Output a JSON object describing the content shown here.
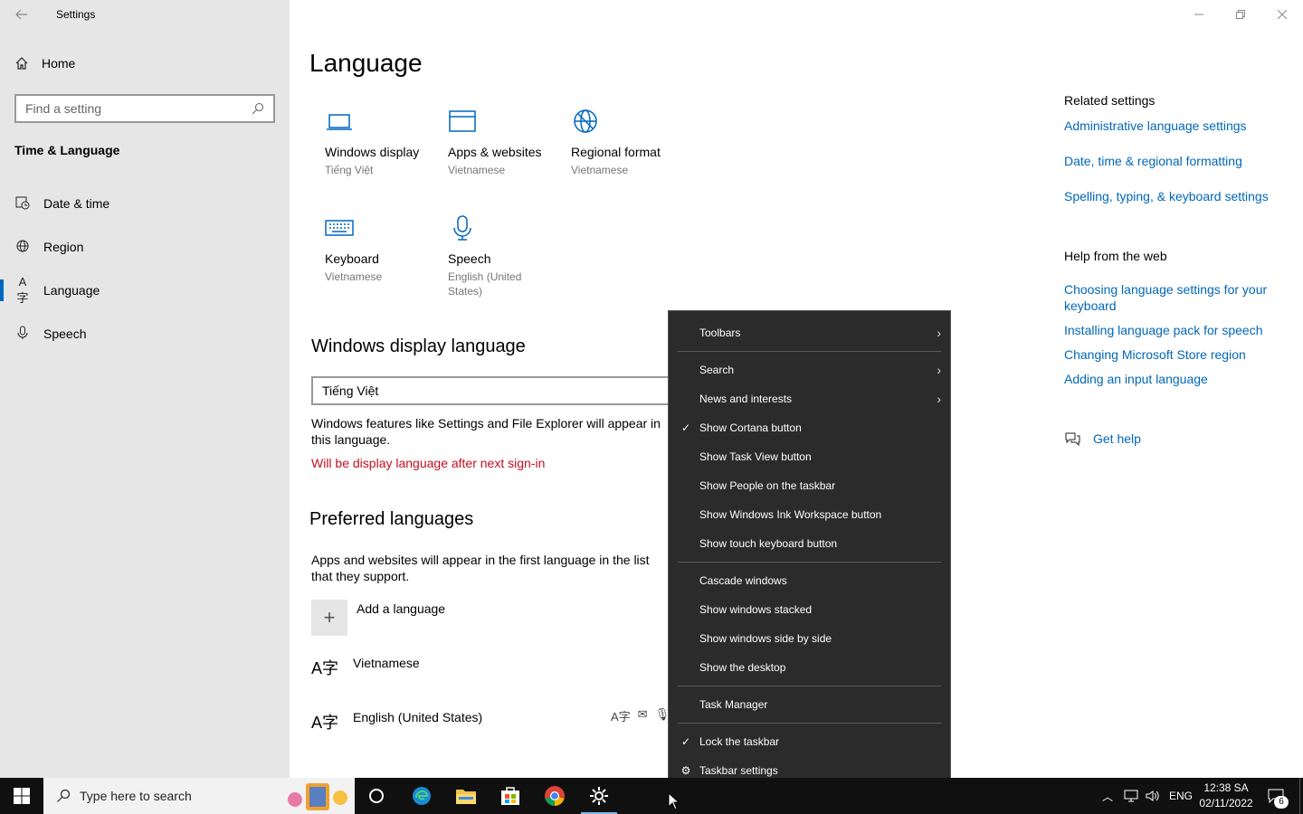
{
  "window": {
    "title": "Settings",
    "back_icon": "back-arrow-icon",
    "controls": [
      "minimize-icon",
      "restore-icon",
      "close-icon"
    ]
  },
  "sidebar": {
    "home_label": "Home",
    "search_placeholder": "Find a setting",
    "section_title": "Time & Language",
    "items": [
      {
        "label": "Date & time",
        "icon": "calendar-clock-icon"
      },
      {
        "label": "Region",
        "icon": "globe-icon"
      },
      {
        "label": "Language",
        "icon": "language-icon",
        "active": true
      },
      {
        "label": "Speech",
        "icon": "microphone-icon"
      }
    ]
  },
  "main": {
    "title": "Language",
    "tiles": [
      {
        "label": "Windows display",
        "sub": "Tiếng Việt",
        "icon": "laptop-icon"
      },
      {
        "label": "Apps & websites",
        "sub": "Vietnamese",
        "icon": "browser-window-icon"
      },
      {
        "label": "Regional format",
        "sub": "Vietnamese",
        "icon": "globe-format-icon"
      },
      {
        "label": "Keyboard",
        "sub": "Vietnamese",
        "icon": "keyboard-icon"
      },
      {
        "label": "Speech",
        "sub": "English (United States)",
        "icon": "microphone-icon"
      }
    ],
    "display_language": {
      "header": "Windows display language",
      "selected": "Tiếng Việt",
      "description": "Windows features like Settings and File Explorer will appear in this language.",
      "warning": "Will be display language after next sign-in"
    },
    "preferred": {
      "header": "Preferred languages",
      "description": "Apps and websites will appear in the first language in the list that they support.",
      "add_label": "Add a language",
      "languages": [
        "Vietnamese",
        "English (United States)"
      ]
    }
  },
  "related": {
    "title": "Related settings",
    "links": [
      "Administrative language settings",
      "Date, time & regional formatting",
      "Spelling, typing, & keyboard settings"
    ],
    "help_title": "Help from the web",
    "help_links": [
      "Choosing language settings for your keyboard",
      "Installing language pack for speech",
      "Changing Microsoft Store region",
      "Adding an input language"
    ],
    "get_help": "Get help"
  },
  "context_menu": {
    "items": [
      {
        "label": "Toolbars",
        "submenu": true
      },
      {
        "label": "Search",
        "submenu": true
      },
      {
        "label": "News and interests",
        "submenu": true
      },
      {
        "label": "Show Cortana button",
        "checked": true
      },
      {
        "label": "Show Task View button"
      },
      {
        "label": "Show People on the taskbar"
      },
      {
        "label": "Show Windows Ink Workspace button"
      },
      {
        "label": "Show touch keyboard button"
      },
      {
        "label": "Cascade windows"
      },
      {
        "label": "Show windows stacked"
      },
      {
        "label": "Show windows side by side"
      },
      {
        "label": "Show the desktop"
      },
      {
        "label": "Task Manager"
      },
      {
        "label": "Lock the taskbar",
        "checked": true
      },
      {
        "label": "Taskbar settings",
        "icon": "gear-icon"
      }
    ]
  },
  "taskbar": {
    "search_placeholder": "Type here to search",
    "language": "ENG",
    "time": "12:38 SA",
    "date": "02/11/2022",
    "notification_count": "6"
  }
}
